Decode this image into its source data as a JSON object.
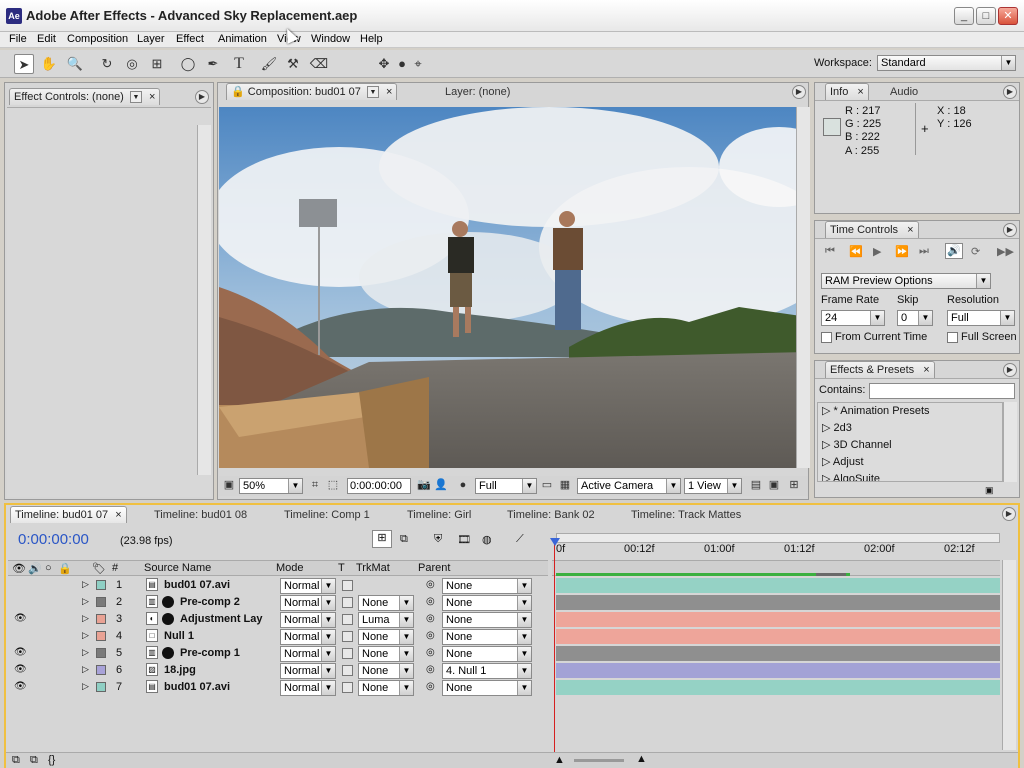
{
  "window": {
    "title": "Adobe After Effects - Advanced Sky Replacement.aep",
    "app_icon_label": "Ae"
  },
  "menu": [
    "File",
    "Edit",
    "Composition",
    "Layer",
    "Effect",
    "Animation",
    "View",
    "Window",
    "Help"
  ],
  "workspace": {
    "label": "Workspace:",
    "value": "Standard"
  },
  "effect_controls": {
    "tab": "Effect Controls: (none)"
  },
  "composition_panel": {
    "tab_comp": "Composition: bud01 07",
    "tab_layer": "Layer: (none)",
    "zoom": "50%",
    "timecode": "0:00:00:00",
    "resolution": "Full",
    "camera": "Active Camera",
    "view": "1 View"
  },
  "info_panel": {
    "tab_info": "Info",
    "tab_audio": "Audio",
    "r": "R : 217",
    "g": "G : 225",
    "b": "B : 222",
    "a": "A : 255",
    "x": "X : 18",
    "y": "Y : 126",
    "swatch_color": "#d9e1de"
  },
  "time_controls": {
    "tab": "Time Controls",
    "ram_preview": "RAM Preview Options",
    "frame_rate_label": "Frame Rate",
    "frame_rate": "24",
    "skip_label": "Skip",
    "skip": "0",
    "resolution_label": "Resolution",
    "resolution": "Full",
    "from_current_time": "From Current Time",
    "full_screen": "Full Screen"
  },
  "effects_presets": {
    "tab": "Effects & Presets",
    "contains_label": "Contains:",
    "items": [
      "* Animation Presets",
      "2d3",
      "3D Channel",
      "Adjust",
      "AlgoSuite"
    ]
  },
  "timeline_tabs": [
    "Timeline: bud01 07",
    "Timeline: bud01 08",
    "Timeline: Comp 1",
    "Timeline: Girl",
    "Timeline: Bank 02",
    "Timeline: Track Mattes"
  ],
  "timeline": {
    "current_time": "0:00:00:00",
    "fps": "(23.98 fps)",
    "headers": {
      "num": "#",
      "source": "Source Name",
      "mode": "Mode",
      "t": "T",
      "trkmat": "TrkMat",
      "parent": "Parent"
    },
    "ruler": [
      "0f",
      "00:12f",
      "01:00f",
      "01:12f",
      "02:00f",
      "02:12f"
    ],
    "layers": [
      {
        "num": "1",
        "name": "bud01 07.avi",
        "mode": "Normal",
        "trkmat": "",
        "parent": "None",
        "color": "#8fcfc4",
        "bar": "#95d2c5",
        "eye": false,
        "icon": "film"
      },
      {
        "num": "2",
        "name": "Pre-comp 2",
        "mode": "Normal",
        "trkmat": "None",
        "parent": "None",
        "color": "#7a7a7a",
        "bar": "#8f8f8f",
        "eye": false,
        "icon": "comp"
      },
      {
        "num": "3",
        "name": "Adjustment Lay",
        "mode": "Normal",
        "trkmat": "Luma",
        "parent": "None",
        "color": "#e9a294",
        "bar": "#eea59a",
        "eye": true,
        "icon": "adj"
      },
      {
        "num": "4",
        "name": "Null 1",
        "mode": "Normal",
        "trkmat": "None",
        "parent": "None",
        "color": "#e9a294",
        "bar": "#eea59a",
        "eye": false,
        "icon": "null"
      },
      {
        "num": "5",
        "name": "Pre-comp 1",
        "mode": "Normal",
        "trkmat": "None",
        "parent": "None",
        "color": "#7a7a7a",
        "bar": "#8f8f8f",
        "eye": true,
        "icon": "comp"
      },
      {
        "num": "6",
        "name": "18.jpg",
        "mode": "Normal",
        "trkmat": "None",
        "parent": "4. Null 1",
        "color": "#a8a2d8",
        "bar": "#a3a2d6",
        "eye": true,
        "icon": "img"
      },
      {
        "num": "7",
        "name": "bud01 07.avi",
        "mode": "Normal",
        "trkmat": "None",
        "parent": "None",
        "color": "#8fcfc4",
        "bar": "#95d2c5",
        "eye": true,
        "icon": "film"
      }
    ]
  }
}
